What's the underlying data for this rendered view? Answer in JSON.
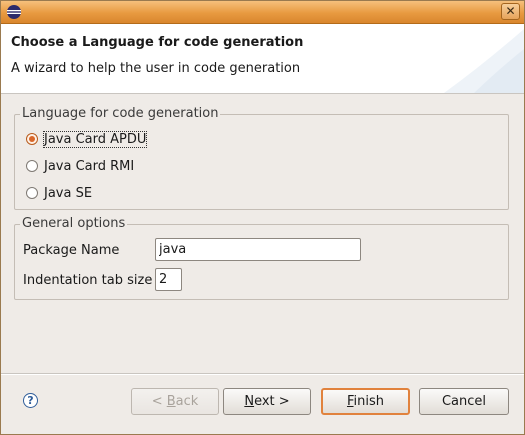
{
  "window": {
    "icon": "eclipse-icon",
    "close_symbol": "✕"
  },
  "header": {
    "title": "Choose a Language for code generation",
    "description": "A wizard to help the user in code generation"
  },
  "language_group": {
    "label": "Language for code generation",
    "options": [
      {
        "label": "Java Card APDU",
        "checked": true
      },
      {
        "label": "Java Card RMI",
        "checked": false
      },
      {
        "label": "Java SE",
        "checked": false
      }
    ]
  },
  "general_group": {
    "label": "General options",
    "package_name_label": "Package Name",
    "package_name_value": "java",
    "indentation_label": "Indentation tab size",
    "indentation_value": "2"
  },
  "buttons": {
    "help_symbol": "?",
    "back_prefix": "< ",
    "back_mnemonic": "B",
    "back_rest": "ack",
    "next_mnemonic": "N",
    "next_rest": "ext >",
    "finish_mnemonic": "F",
    "finish_rest": "inish",
    "cancel": "Cancel"
  },
  "colors": {
    "accent": "#e1823d",
    "titlebar": "#e89a40",
    "background": "#efebe7"
  }
}
